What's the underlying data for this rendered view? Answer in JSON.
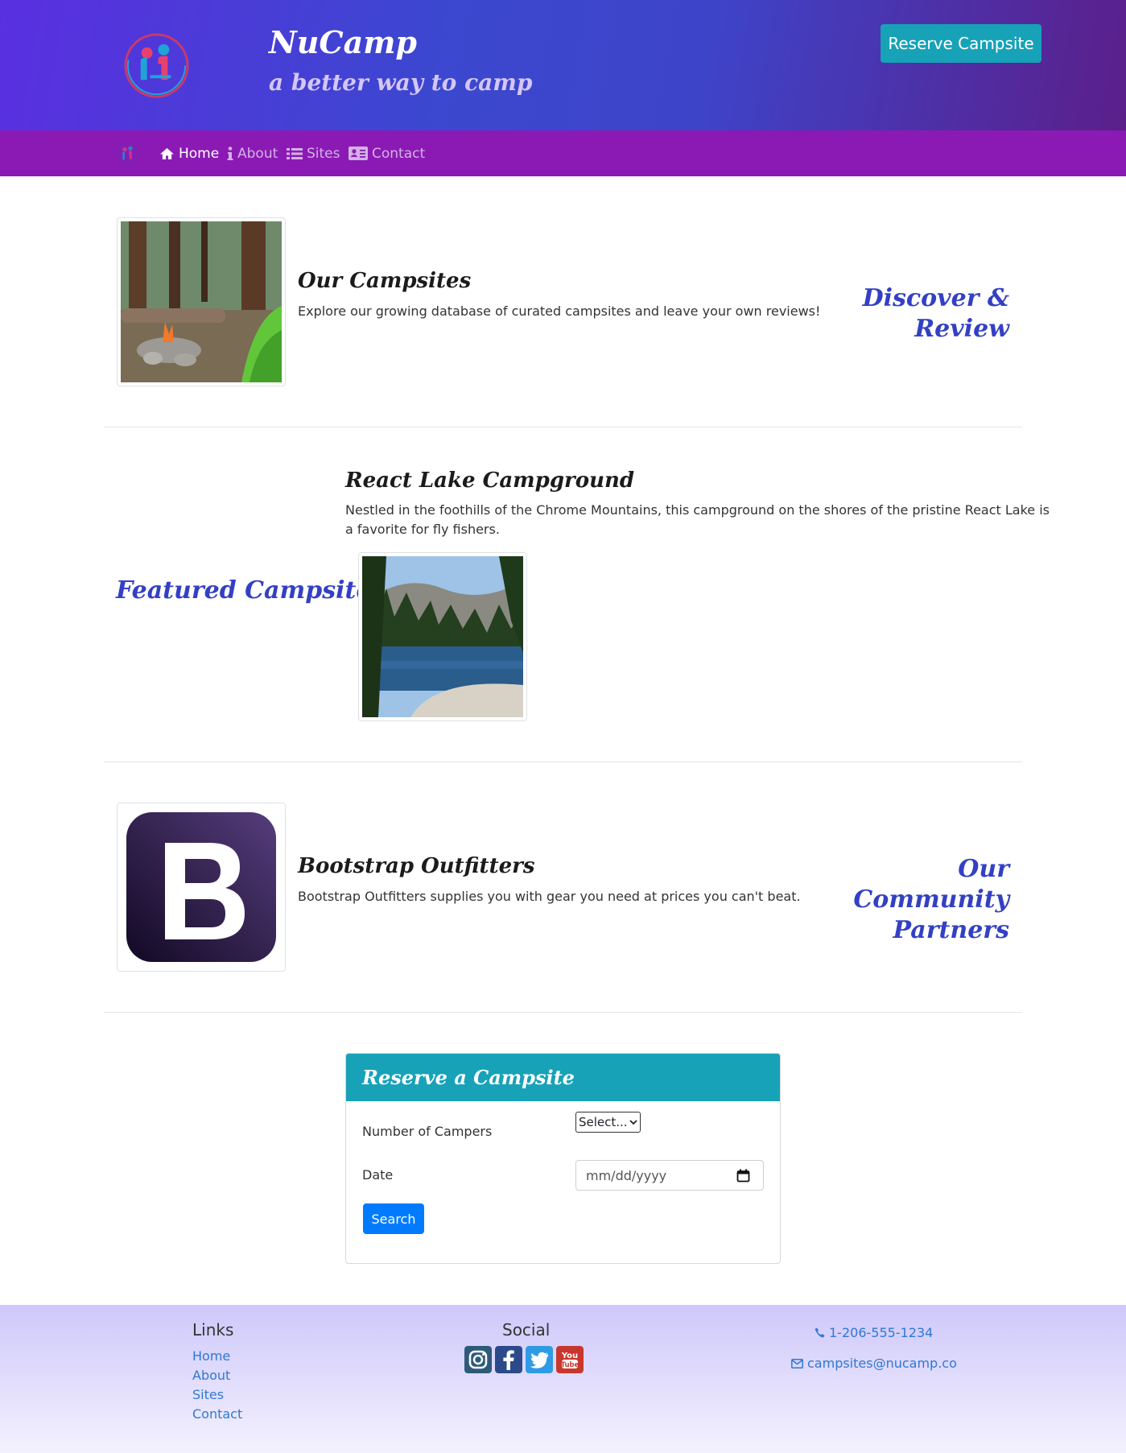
{
  "header": {
    "brand_title": "NuCamp",
    "brand_subtitle": "a better way to camp",
    "reserve_button": "Reserve Campsite"
  },
  "nav": {
    "items": [
      {
        "label": "Home",
        "icon": "home-icon",
        "active": true
      },
      {
        "label": "About",
        "icon": "info-icon",
        "active": false
      },
      {
        "label": "Sites",
        "icon": "list-icon",
        "active": false
      },
      {
        "label": "Contact",
        "icon": "address-card-icon",
        "active": false
      }
    ]
  },
  "sections": {
    "campsites": {
      "title": "Our Campsites",
      "text": "Explore our growing database of curated campsites and leave your own reviews!",
      "label": "Discover & Review"
    },
    "featured": {
      "title": "React Lake Campground",
      "text_line1": "Nestled in the foothills of the Chrome Mountains, this campground on the shores of the pristine React Lake is",
      "text_line2": "a favorite for fly fishers.",
      "label": "Featured Campsites"
    },
    "partners": {
      "title": "Bootstrap Outfitters",
      "text": "Bootstrap Outfitters supplies you with gear you need at prices you can't beat.",
      "label_line1": "Our Community",
      "label_line2": "Partners"
    }
  },
  "reserve_form": {
    "title": "Reserve a Campsite",
    "campers_label": "Number of Campers",
    "campers_value": "Select...",
    "date_label": "Date",
    "date_placeholder": "mm/dd/yyyy",
    "search_button": "Search"
  },
  "footer": {
    "links_heading": "Links",
    "links": [
      "Home",
      "About",
      "Sites",
      "Contact"
    ],
    "social_heading": "Social",
    "social_icons": [
      "instagram-icon",
      "facebook-icon",
      "twitter-icon",
      "youtube-icon"
    ],
    "phone": "1-206-555-1234",
    "email": "campsites@nucamp.co"
  },
  "colors": {
    "accent_teal": "#17a2b8",
    "navbar_purple": "#8b1ab4",
    "heading_blue": "#3340c4",
    "link_blue": "#2f78d4",
    "primary_blue": "#007bff"
  }
}
